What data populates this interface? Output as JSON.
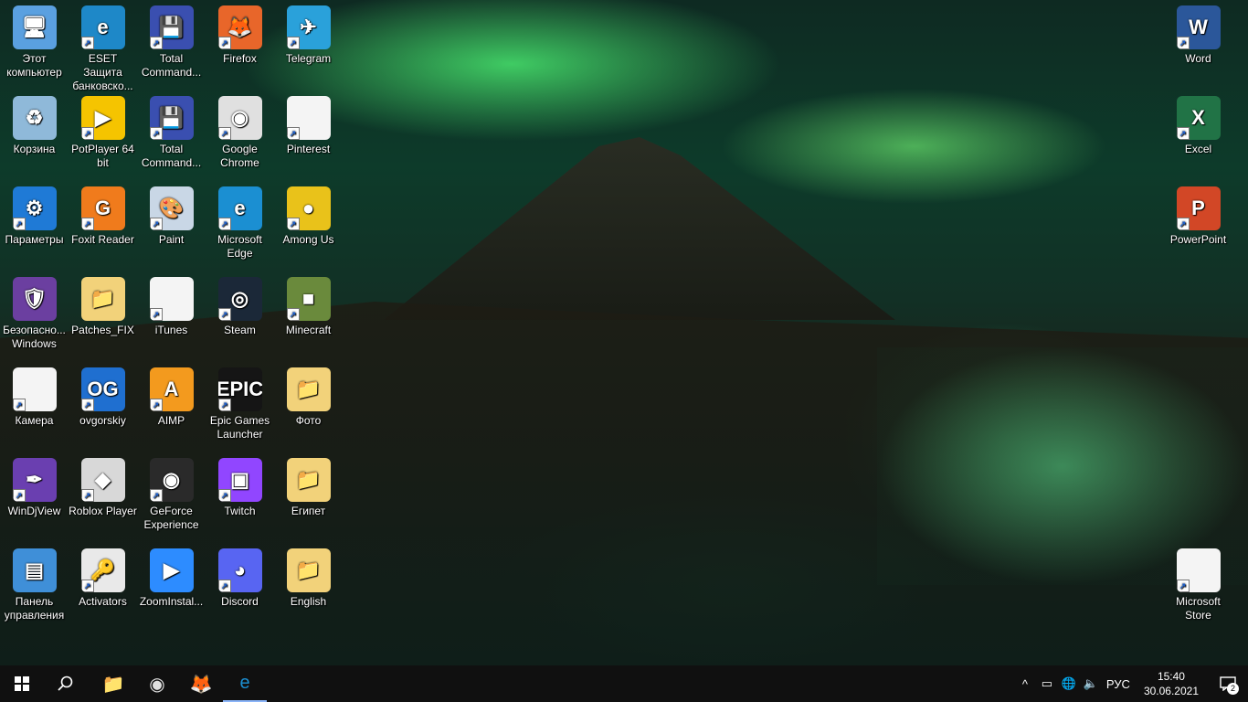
{
  "desktop": {
    "icons": [
      {
        "label": "Этот компьютер",
        "glyph": "🖥",
        "bg": "#5aa0e0",
        "shortcut": false
      },
      {
        "label": "ESET Защита банковско...",
        "glyph": "e",
        "bg": "#1e88c8",
        "shortcut": true
      },
      {
        "label": "Total Command...",
        "glyph": "💾",
        "bg": "#3a4fb0",
        "shortcut": true
      },
      {
        "label": "Firefox",
        "glyph": "🦊",
        "bg": "#e8662a",
        "shortcut": true
      },
      {
        "label": "Telegram",
        "glyph": "✈",
        "bg": "#2aa1da",
        "shortcut": true
      },
      {
        "label": "Корзина",
        "glyph": "♻",
        "bg": "#8fb9d9",
        "shortcut": false
      },
      {
        "label": "PotPlayer 64 bit",
        "glyph": "▶",
        "bg": "#f5c400",
        "shortcut": true
      },
      {
        "label": "Total Command...",
        "glyph": "💾",
        "bg": "#3a4fb0",
        "shortcut": true
      },
      {
        "label": "Google Chrome",
        "glyph": "◉",
        "bg": "#e0e0e0",
        "shortcut": true
      },
      {
        "label": "Pinterest",
        "glyph": "",
        "bg": "#f4f4f4",
        "shortcut": true
      },
      {
        "label": "Параметры",
        "glyph": "⚙",
        "bg": "#1f7ad6",
        "shortcut": true
      },
      {
        "label": "Foxit Reader",
        "glyph": "G",
        "bg": "#f07b1c",
        "shortcut": true
      },
      {
        "label": "Paint",
        "glyph": "🎨",
        "bg": "#c9d7e6",
        "shortcut": true
      },
      {
        "label": "Microsoft Edge",
        "glyph": "e",
        "bg": "#1b8fd2",
        "shortcut": true
      },
      {
        "label": "Among Us",
        "glyph": "●",
        "bg": "#e9c21a",
        "shortcut": true
      },
      {
        "label": "Безопасно... Windows",
        "glyph": "🛡",
        "bg": "#6b3fa0",
        "shortcut": false
      },
      {
        "label": "Patches_FIX",
        "glyph": "📁",
        "bg": "#f2d27a",
        "shortcut": false
      },
      {
        "label": "iTunes",
        "glyph": "",
        "bg": "#f4f4f4",
        "shortcut": true
      },
      {
        "label": "Steam",
        "glyph": "◎",
        "bg": "#1b2838",
        "shortcut": true
      },
      {
        "label": "Minecraft",
        "glyph": "■",
        "bg": "#6a8a3c",
        "shortcut": true
      },
      {
        "label": "Камера",
        "glyph": "",
        "bg": "#f4f4f4",
        "shortcut": true
      },
      {
        "label": "ovgorskiy",
        "glyph": "OG",
        "bg": "#1f6fd0",
        "shortcut": true
      },
      {
        "label": "AIMP",
        "glyph": "A",
        "bg": "#f39a1e",
        "shortcut": true
      },
      {
        "label": "Epic Games Launcher",
        "glyph": "EPIC",
        "bg": "#151515",
        "shortcut": true
      },
      {
        "label": "Фото",
        "glyph": "📁",
        "bg": "#f2d27a",
        "shortcut": false
      },
      {
        "label": "WinDjView",
        "glyph": "✒",
        "bg": "#6a3fb0",
        "shortcut": true
      },
      {
        "label": "Roblox Player",
        "glyph": "◆",
        "bg": "#d8d8d8",
        "shortcut": true
      },
      {
        "label": "GeForce Experience",
        "glyph": "◉",
        "bg": "#2a2a2a",
        "shortcut": true
      },
      {
        "label": "Twitch",
        "glyph": "▣",
        "bg": "#9146ff",
        "shortcut": true
      },
      {
        "label": "Египет",
        "glyph": "📁",
        "bg": "#f2d27a",
        "shortcut": false
      },
      {
        "label": "Панель управления",
        "glyph": "▤",
        "bg": "#3f8fd8",
        "shortcut": false
      },
      {
        "label": "Activators",
        "glyph": "🔑",
        "bg": "#e9e9e9",
        "shortcut": true
      },
      {
        "label": "ZoomInstal...",
        "glyph": "▶",
        "bg": "#2d8cff",
        "shortcut": false
      },
      {
        "label": "Discord",
        "glyph": "◕",
        "bg": "#5865f2",
        "shortcut": true
      },
      {
        "label": "English",
        "glyph": "📁",
        "bg": "#f2d27a",
        "shortcut": false
      }
    ],
    "right_icons": [
      {
        "label": "Word",
        "glyph": "W",
        "bg": "#2b579a",
        "shortcut": true
      },
      {
        "label": "Excel",
        "glyph": "X",
        "bg": "#217346",
        "shortcut": true
      },
      {
        "label": "PowerPoint",
        "glyph": "P",
        "bg": "#d24726",
        "shortcut": true
      },
      {
        "label": "Microsoft Store",
        "glyph": "",
        "bg": "#f4f4f4",
        "shortcut": true
      }
    ]
  },
  "taskbar": {
    "start_icon": "start-icon",
    "search_icon": "search-icon",
    "apps": [
      {
        "name": "file-explorer",
        "glyph": "📁",
        "color": "#f2c14e",
        "active": false
      },
      {
        "name": "chrome",
        "glyph": "◉",
        "color": "#e0e0e0",
        "active": false
      },
      {
        "name": "firefox",
        "glyph": "🦊",
        "color": "#e8662a",
        "active": false
      },
      {
        "name": "edge",
        "glyph": "e",
        "color": "#1b8fd2",
        "active": true
      }
    ],
    "tray": {
      "chevron": "^",
      "language": "РУС",
      "time": "15:40",
      "date": "30.06.2021",
      "notification_count": "2"
    }
  }
}
